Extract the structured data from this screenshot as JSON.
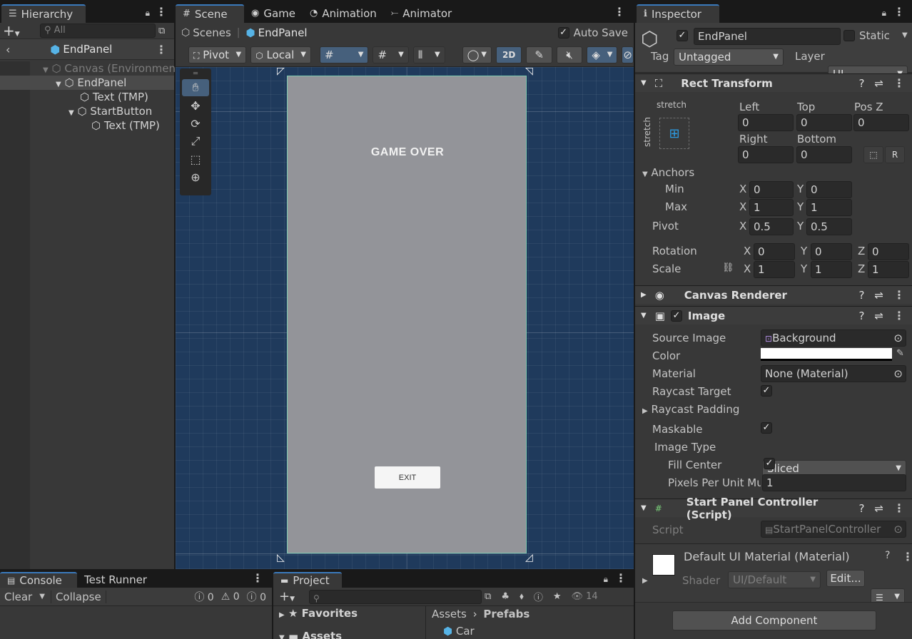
{
  "hierarchy": {
    "tab": "Hierarchy",
    "search_placeholder": "All",
    "context": "EndPanel",
    "items": [
      {
        "label": "Canvas (Environmen",
        "depth": 0
      },
      {
        "label": "EndPanel",
        "depth": 1
      },
      {
        "label": "Text (TMP)",
        "depth": 2
      },
      {
        "label": "StartButton",
        "depth": 2
      },
      {
        "label": "Text (TMP)",
        "depth": 3
      }
    ]
  },
  "scene_tabs": [
    "Scene",
    "Game",
    "Animation",
    "Animator"
  ],
  "scene": {
    "breadcrumb_root": "Scenes",
    "breadcrumb_item": "EndPanel",
    "auto_save": "Auto Save",
    "pivot": "Pivot",
    "local": "Local",
    "mode_2d": "2D",
    "panel_title": "GAME OVER",
    "exit_button": "EXIT"
  },
  "inspector": {
    "tab": "Inspector",
    "object_name": "EndPanel",
    "static_label": "Static",
    "tag_label": "Tag",
    "tag_value": "Untagged",
    "layer_label": "Layer",
    "layer_value": "UI",
    "rect_transform": {
      "title": "Rect Transform",
      "stretch_top": "stretch",
      "stretch_side": "stretch",
      "left_label": "Left",
      "left": "0",
      "top_label": "Top",
      "top": "0",
      "posz_label": "Pos Z",
      "posz": "0",
      "right_label": "Right",
      "right": "0",
      "bottom_label": "Bottom",
      "bottom": "0",
      "anchors_label": "Anchors",
      "min_label": "Min",
      "min_x": "0",
      "min_y": "0",
      "max_label": "Max",
      "max_x": "1",
      "max_y": "1",
      "pivot_label": "Pivot",
      "pivot_x": "0.5",
      "pivot_y": "0.5",
      "rotation_label": "Rotation",
      "rot_x": "0",
      "rot_y": "0",
      "rot_z": "0",
      "scale_label": "Scale",
      "scale_x": "1",
      "scale_y": "1",
      "scale_z": "1"
    },
    "canvas_renderer": "Canvas Renderer",
    "image": {
      "title": "Image",
      "source_image_label": "Source Image",
      "source_image": "Background",
      "color_label": "Color",
      "material_label": "Material",
      "material": "None (Material)",
      "raycast_target_label": "Raycast Target",
      "raycast_padding_label": "Raycast Padding",
      "maskable_label": "Maskable",
      "image_type_label": "Image Type",
      "image_type": "Sliced",
      "fill_center_label": "Fill Center",
      "ppu_label": "Pixels Per Unit Mu",
      "ppu": "1"
    },
    "script_component": {
      "title": "Start Panel Controller (Script)",
      "script_label": "Script",
      "script_value": "StartPanelController"
    },
    "material_preview": {
      "name": "Default UI Material (Material)",
      "shader_label": "Shader",
      "shader_value": "UI/Default",
      "edit": "Edit..."
    },
    "add_component": "Add Component"
  },
  "console": {
    "tab": "Console",
    "tab2": "Test Runner",
    "clear": "Clear",
    "collapse": "Collapse",
    "count_info": "0",
    "count_warn": "0",
    "count_err": "0"
  },
  "project": {
    "tab": "Project",
    "favorites": "Favorites",
    "assets_tree": "Assets",
    "crumb_assets": "Assets",
    "crumb_prefabs": "Prefabs",
    "item": "Car",
    "visible_count": "14"
  },
  "colors": {
    "accent": "#3a79bb",
    "scene_bg": "#1f3a5c",
    "panel_gray": "#939499"
  }
}
